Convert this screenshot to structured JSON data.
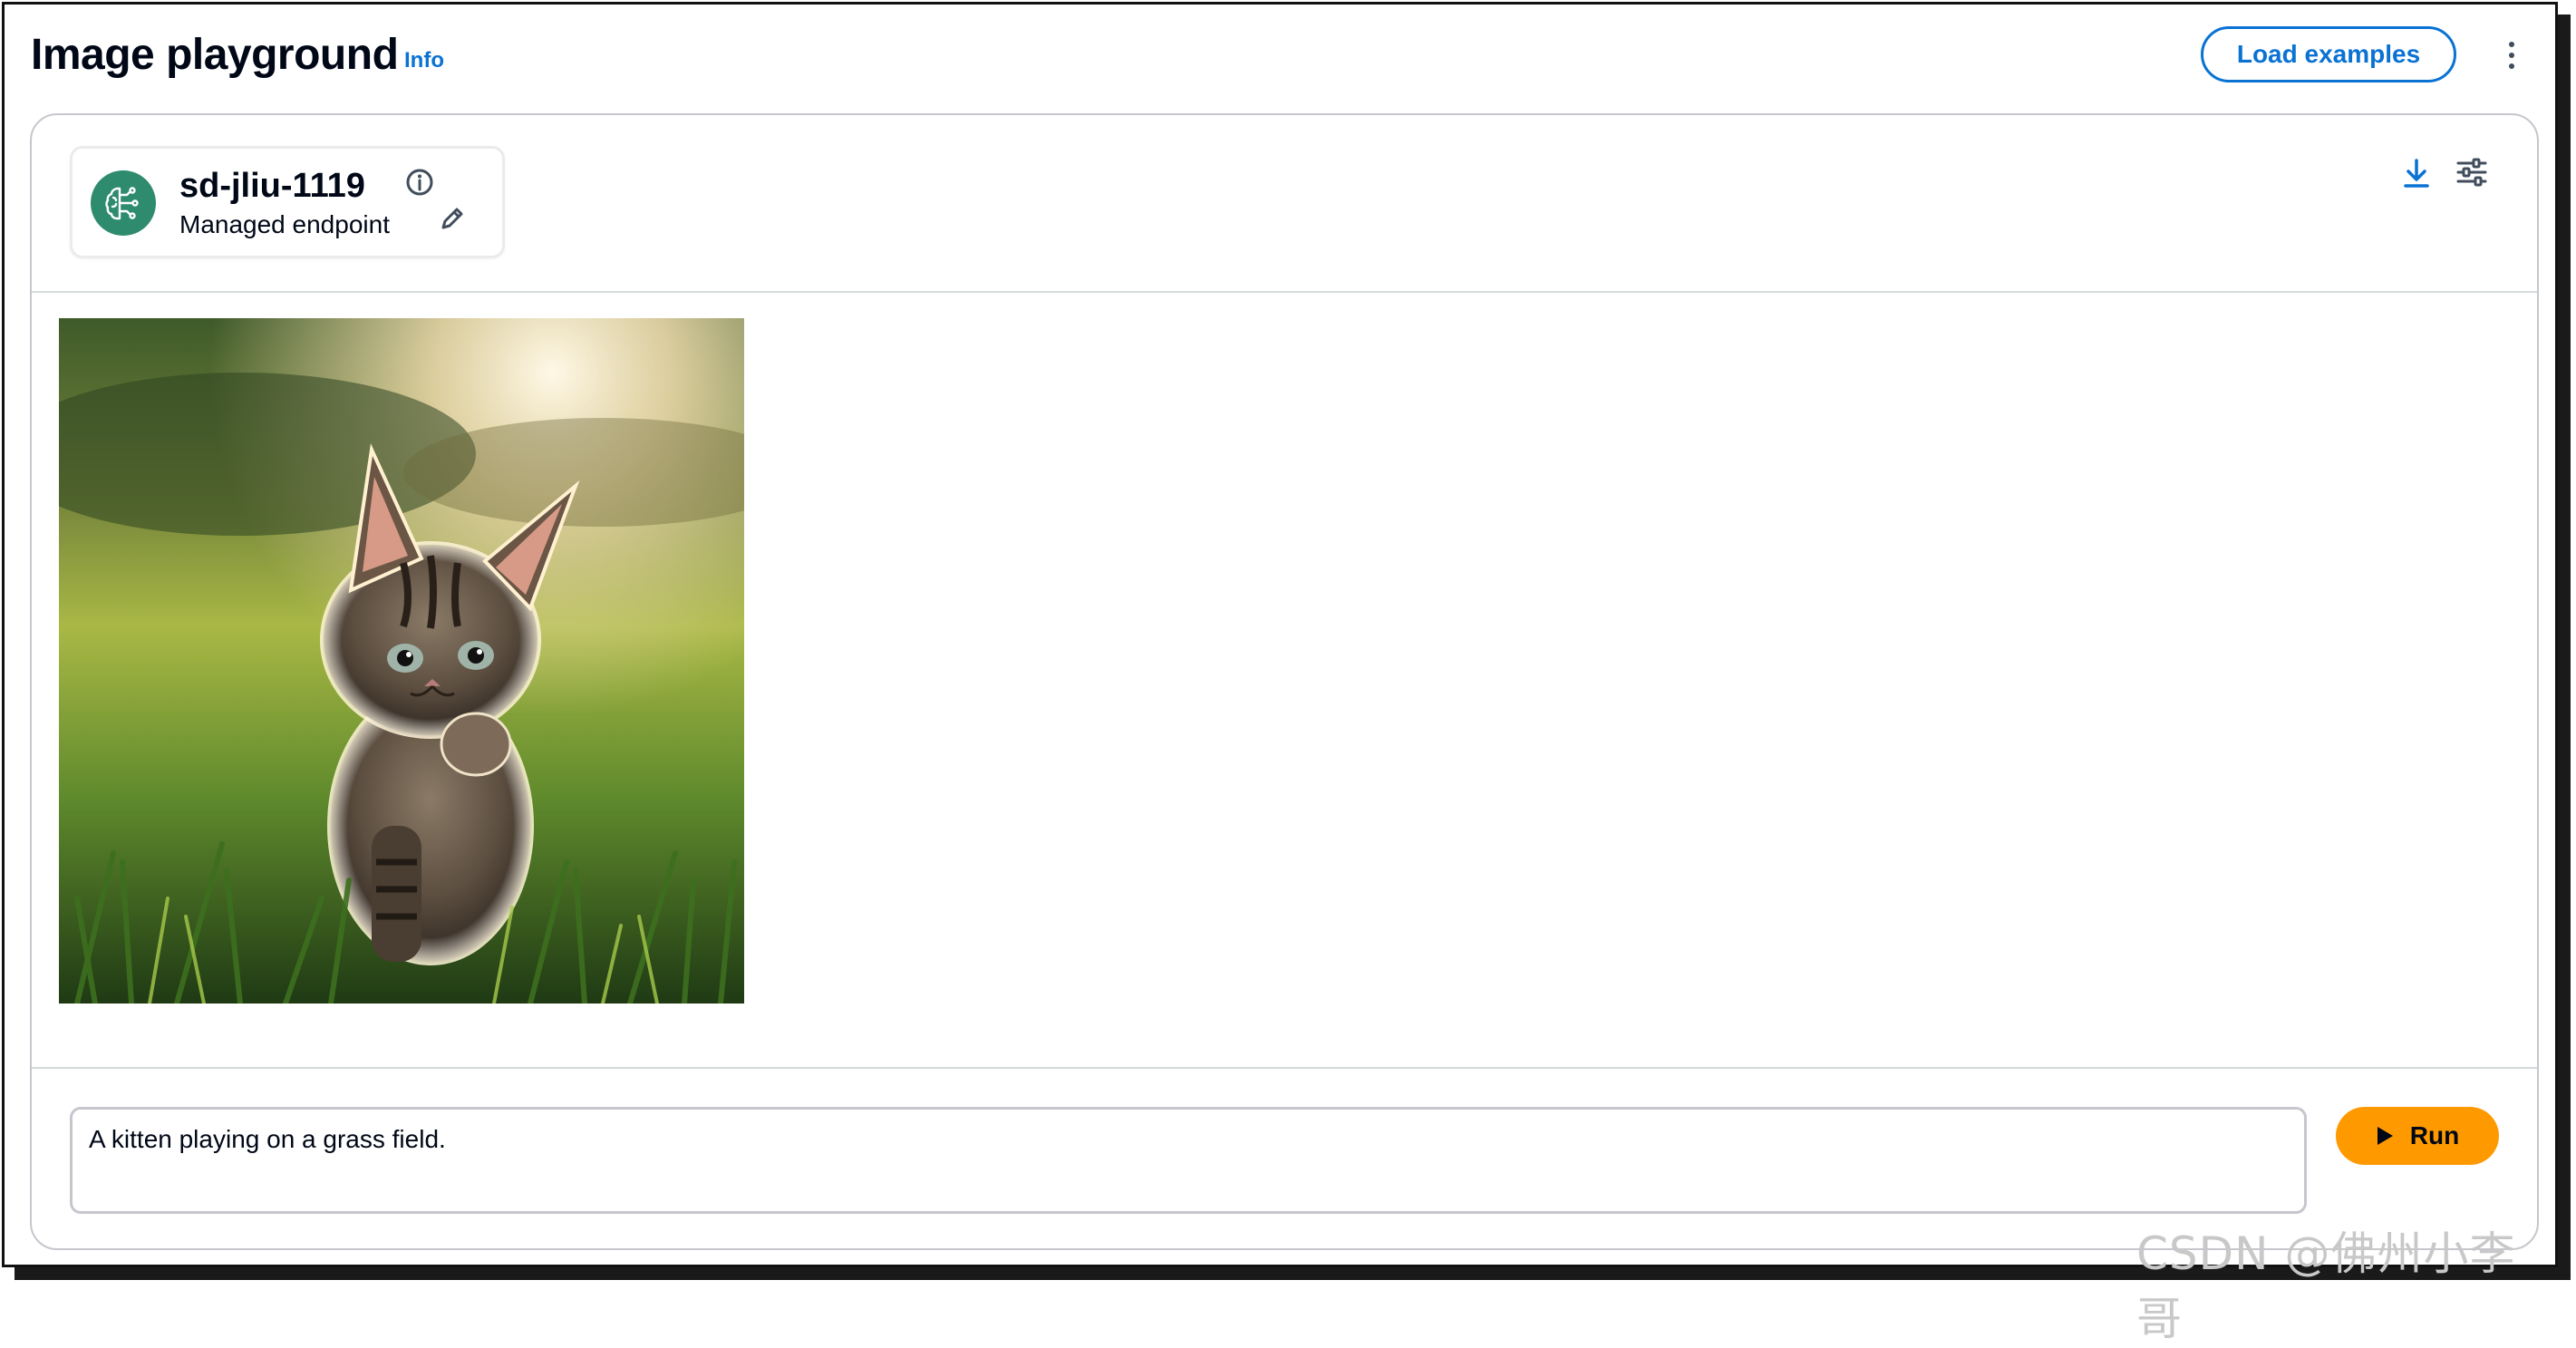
{
  "header": {
    "title": "Image playground",
    "info_label": "Info",
    "load_examples_label": "Load examples"
  },
  "model": {
    "name": "sd-jliu-1119",
    "type": "Managed endpoint"
  },
  "output": {
    "image_subject": "kitten in grass field at sunset"
  },
  "prompt": {
    "value": "A kitten playing on a grass field."
  },
  "run_label": "Run",
  "watermark": "CSDN @佛州小李哥",
  "colors": {
    "accent_blue": "#0972d3",
    "run_orange": "#ff9900",
    "model_avatar_green": "#2e8b6e",
    "title_text": "#000716"
  },
  "icons": {
    "info": "info-icon",
    "kebab": "more-vertical-icon",
    "model": "brain-circuit-icon",
    "model_info": "info-circle-icon",
    "edit": "pencil-icon",
    "download": "download-icon",
    "settings": "sliders-icon",
    "run": "play-icon"
  }
}
